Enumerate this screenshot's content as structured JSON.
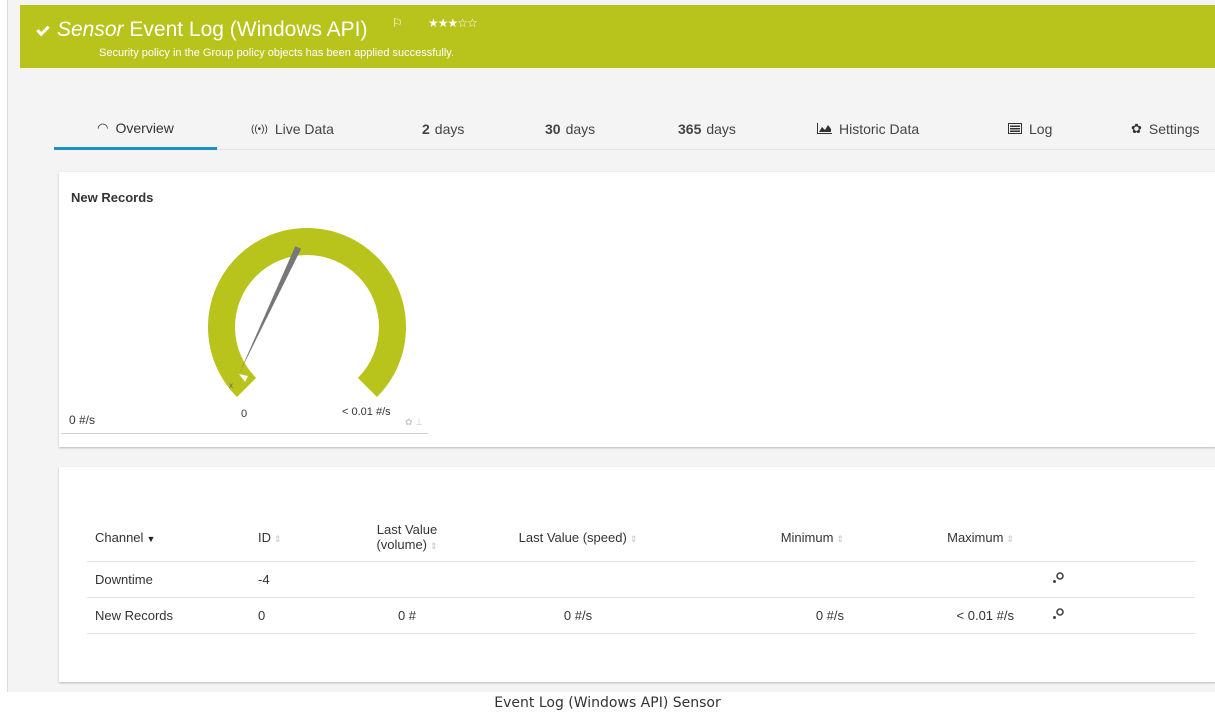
{
  "banner": {
    "sensor_type": "Sensor",
    "sensor_name": "Event Log (Windows API)",
    "flag_icon": "⚐",
    "stars": "★★★☆☆",
    "message": "Security policy in the Group policy objects has been applied successfully.",
    "color": "#b8c41c"
  },
  "tabs": [
    {
      "label": "Overview",
      "icon": "gauge-icon",
      "active": true
    },
    {
      "label": "Live Data",
      "icon": "live-signal-icon"
    },
    {
      "num": "2",
      "label": "days"
    },
    {
      "num": "30",
      "label": "days"
    },
    {
      "num": "365",
      "label": "days"
    },
    {
      "label": "Historic Data",
      "icon": "area-chart-icon"
    },
    {
      "label": "Log",
      "icon": "list-icon"
    },
    {
      "label": "Settings",
      "icon": "gear-icon"
    }
  ],
  "gauge": {
    "title": "New Records",
    "current_value": "0 #/s",
    "min_label": "0",
    "max_label": "< 0.01 #/s",
    "needle_fraction": 0.62,
    "color": "#b8c41c"
  },
  "table": {
    "headers": {
      "channel": "Channel",
      "id": "ID",
      "last_value_volume_line1": "Last Value",
      "last_value_volume_line2": "(volume)",
      "last_value_speed": "Last Value (speed)",
      "minimum": "Minimum",
      "maximum": "Maximum"
    },
    "rows": [
      {
        "channel": "Downtime",
        "id": "-4",
        "volume": "",
        "speed": "",
        "minimum": "",
        "maximum": ""
      },
      {
        "channel": "New Records",
        "id": "0",
        "volume": "0 #",
        "speed": "0 #/s",
        "minimum": "0 #/s",
        "maximum": "< 0.01 #/s"
      }
    ]
  },
  "caption": "Event Log (Windows API) Sensor"
}
